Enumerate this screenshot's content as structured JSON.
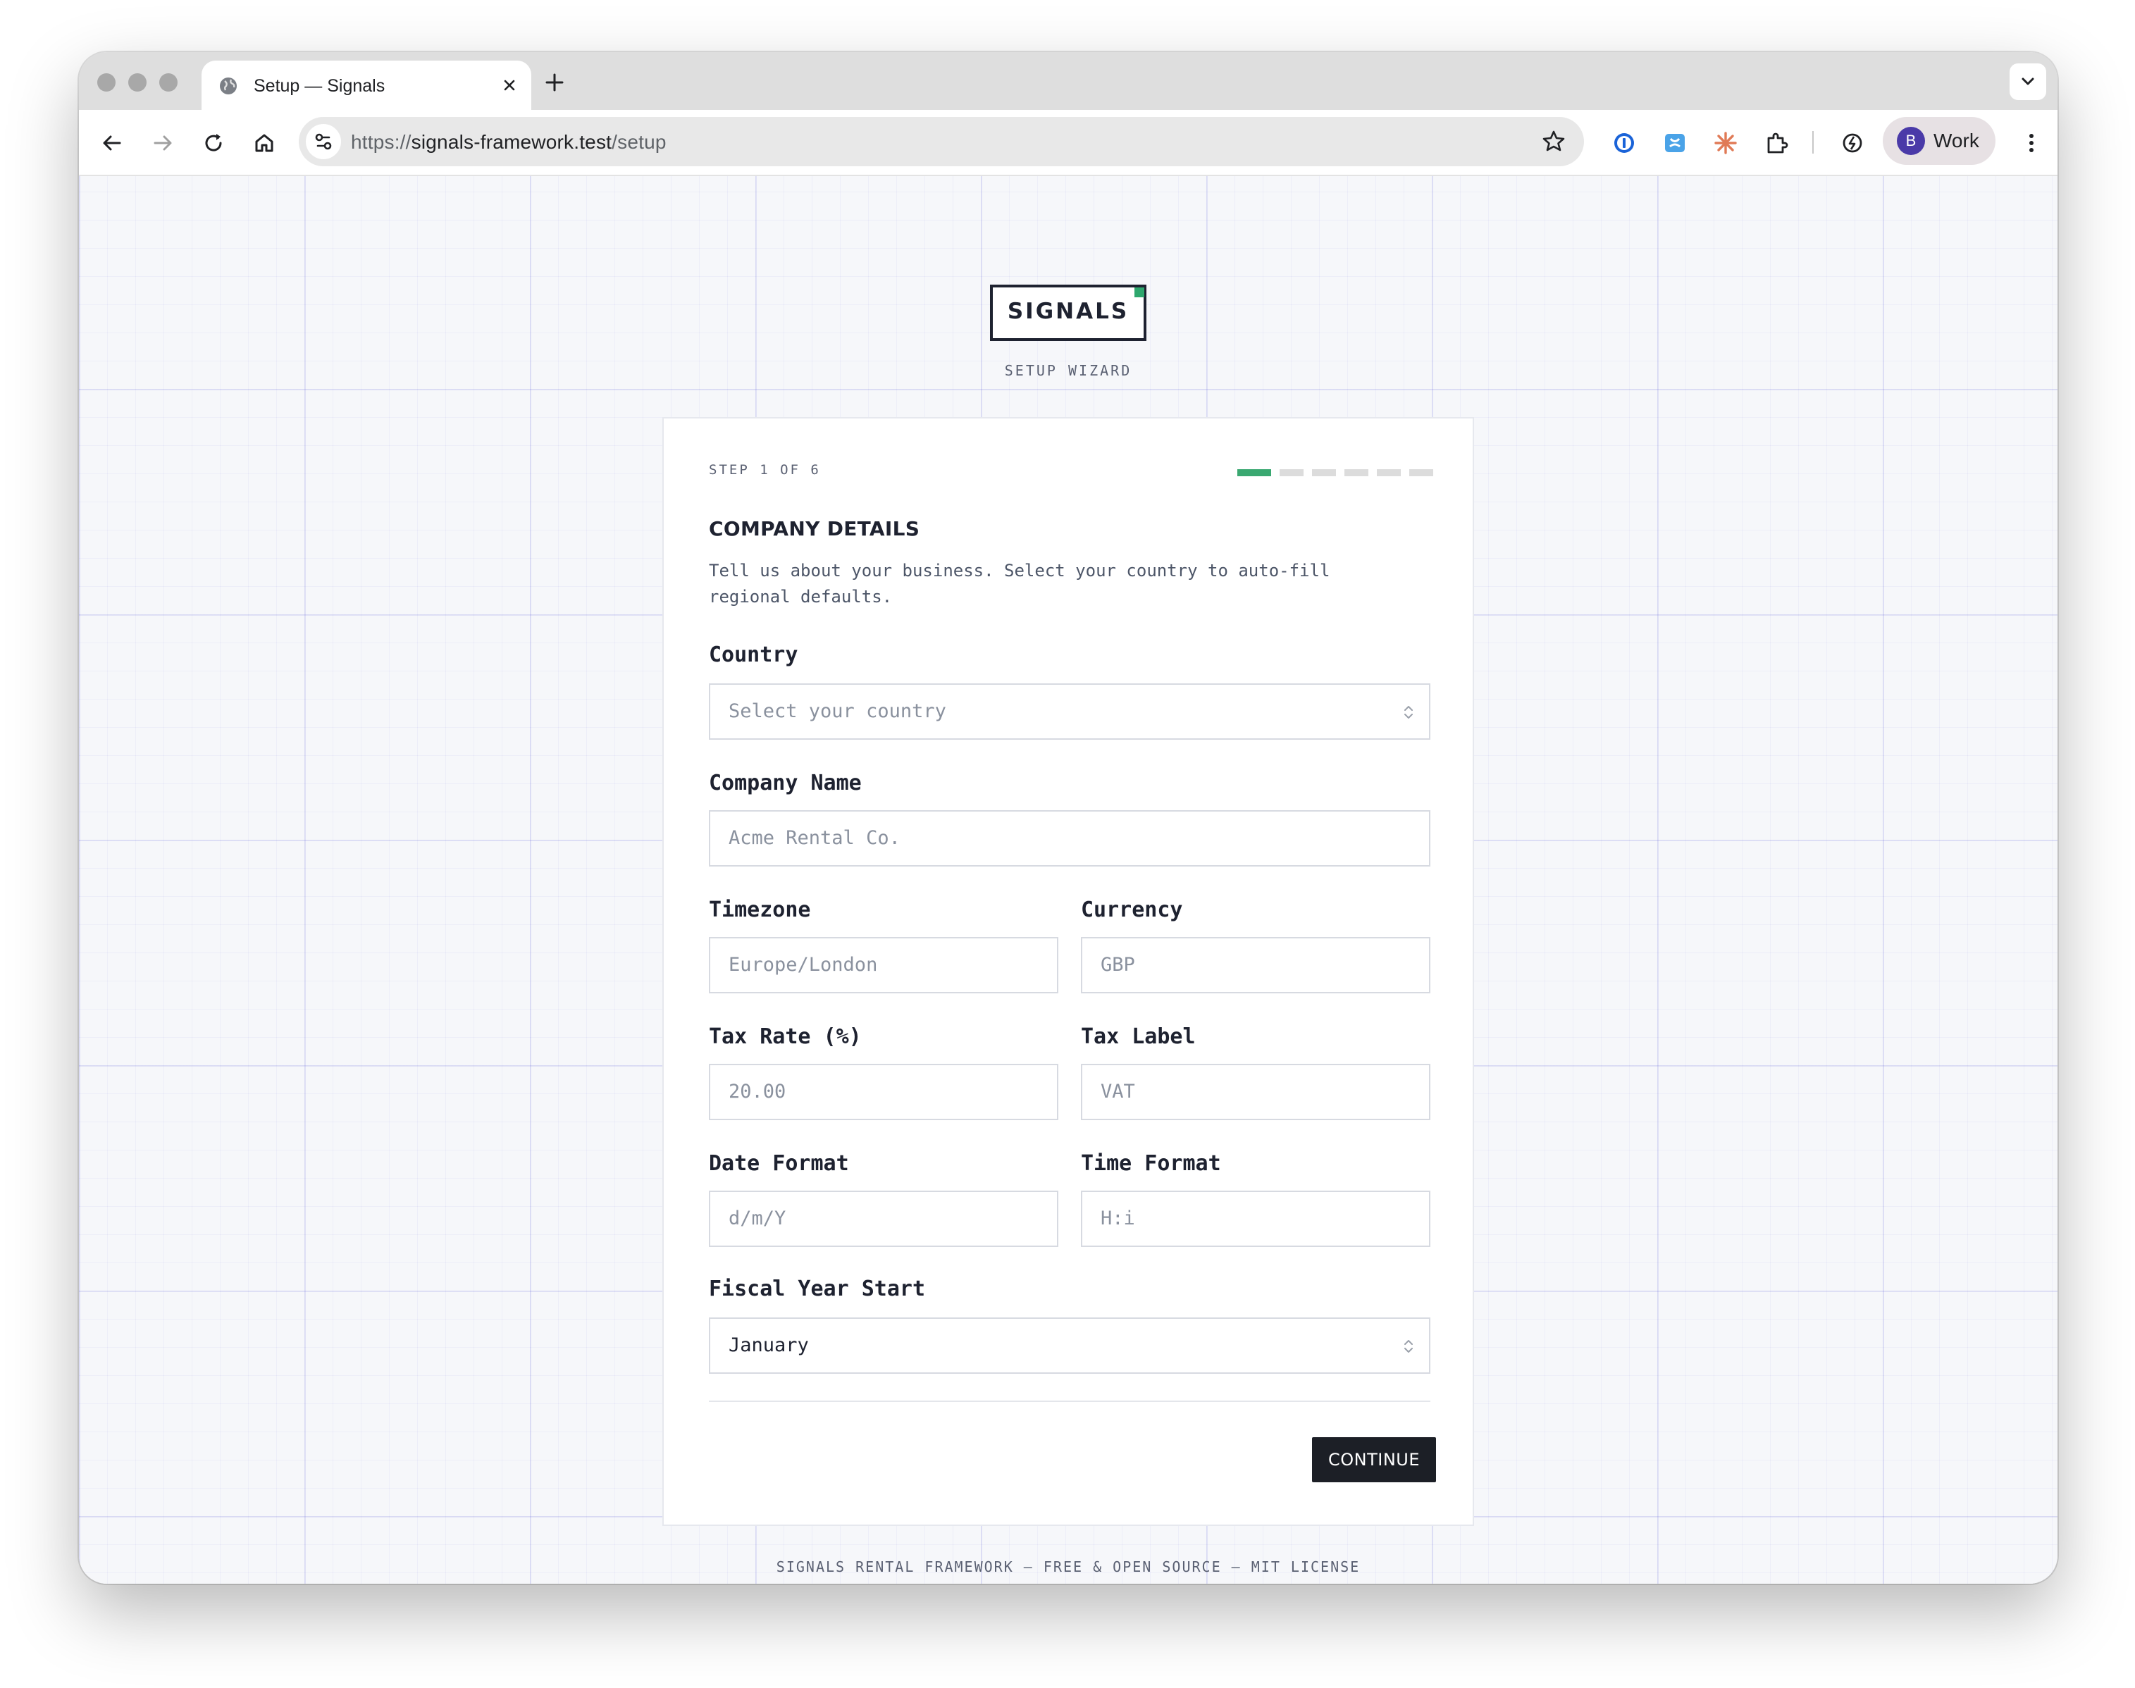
{
  "browser": {
    "tab_title": "Setup — Signals",
    "url_prefix": "https://",
    "url_host": "signals-framework.test",
    "url_path": "/setup",
    "profile_initial": "B",
    "profile_label": "Work"
  },
  "header": {
    "logo": "SIGNALS",
    "subtitle": "SETUP WIZARD"
  },
  "wizard": {
    "step_label": "STEP 1 OF 6",
    "step_current": 1,
    "step_total": 6,
    "title": "COMPANY DETAILS",
    "description": "Tell us about your business. Select your country to auto-fill regional defaults.",
    "fields": {
      "country": {
        "label": "Country",
        "placeholder": "Select your country"
      },
      "company_name": {
        "label": "Company Name",
        "placeholder": "Acme Rental Co."
      },
      "timezone": {
        "label": "Timezone",
        "placeholder": "Europe/London"
      },
      "currency": {
        "label": "Currency",
        "placeholder": "GBP"
      },
      "tax_rate": {
        "label": "Tax Rate (%)",
        "placeholder": "20.00"
      },
      "tax_label": {
        "label": "Tax Label",
        "placeholder": "VAT"
      },
      "date_format": {
        "label": "Date Format",
        "placeholder": "d/m/Y"
      },
      "time_format": {
        "label": "Time Format",
        "placeholder": "H:i"
      },
      "fiscal_year_start": {
        "label": "Fiscal Year Start",
        "value": "January"
      }
    },
    "continue_label": "CONTINUE"
  },
  "footer": {
    "text": "SIGNALS RENTAL FRAMEWORK — FREE & OPEN SOURCE — MIT LICENSE"
  },
  "colors": {
    "accent": "#3aa871",
    "dark": "#1e2230",
    "page_bg": "#f6f7fa"
  }
}
